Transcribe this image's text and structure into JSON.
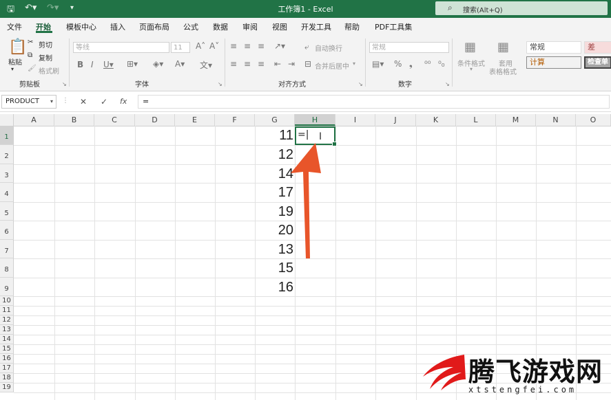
{
  "window": {
    "title": "工作簿1  -  Excel",
    "search_placeholder": "搜索(Alt+Q)"
  },
  "tabs": [
    "文件",
    "开始",
    "模板中心",
    "插入",
    "页面布局",
    "公式",
    "数据",
    "审阅",
    "视图",
    "开发工具",
    "帮助",
    "PDF工具集"
  ],
  "active_tab": "开始",
  "ribbon": {
    "clipboard": {
      "paste": "粘贴",
      "cut": "剪切",
      "copy": "复制",
      "format_painter": "格式刷",
      "group": "剪贴板"
    },
    "font": {
      "font_name": "等线",
      "font_size": "11",
      "group": "字体"
    },
    "alignment": {
      "wrap_text": "自动换行",
      "merge_center": "合并后居中",
      "group": "对齐方式"
    },
    "number": {
      "format": "常规",
      "percent": "%",
      "group": "数字"
    },
    "styles": {
      "conditional": "条件格式",
      "table_format_1": "套用",
      "table_format_2": "表格格式",
      "style_normal": "常规",
      "style_bad": "差",
      "style_calc": "计算",
      "style_check": "检查单"
    }
  },
  "formula_bar": {
    "name_box": "PRODUCT",
    "cancel_icon": "✕",
    "enter_icon": "✓",
    "fx_label": "fx",
    "value": "="
  },
  "columns": [
    "A",
    "B",
    "C",
    "D",
    "E",
    "F",
    "G",
    "H",
    "I",
    "J",
    "K",
    "L",
    "M",
    "N",
    "O"
  ],
  "selected_column": "H",
  "rows": [
    "1",
    "2",
    "3",
    "4",
    "5",
    "6",
    "7",
    "8",
    "9",
    "10",
    "11",
    "12",
    "13",
    "14",
    "15",
    "16",
    "17",
    "18",
    "19"
  ],
  "column_g_values": [
    "11",
    "12",
    "14",
    "17",
    "19",
    "20",
    "13",
    "15",
    "16"
  ],
  "active_cell": {
    "ref": "H1",
    "text": "=|"
  },
  "annotation": {
    "arrow_color": "#e8552a"
  },
  "watermark": {
    "text": "腾飞游戏网",
    "url": "xtstengfei.com"
  },
  "colors": {
    "excel_green": "#217346",
    "ribbon_bg": "#f3f3f3"
  }
}
